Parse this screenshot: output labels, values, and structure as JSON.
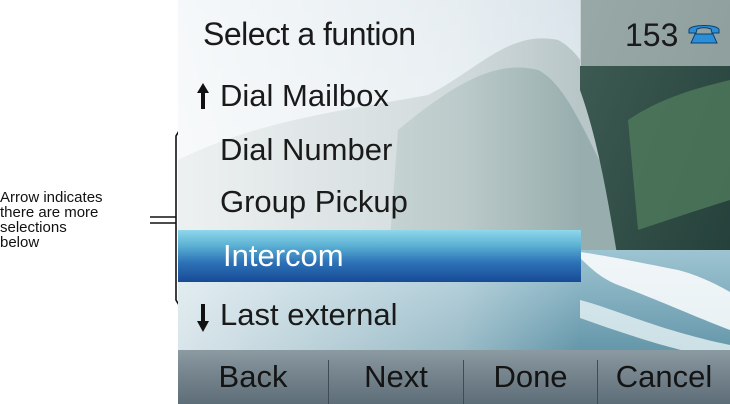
{
  "annotation": {
    "lines": [
      "Arrow indicates",
      "there are more",
      "selections",
      "below"
    ]
  },
  "screen": {
    "title": "Select a funtion",
    "status": {
      "line_number": "153",
      "icon": "phone-handset-icon",
      "icon_color": "#2a8fd8"
    },
    "menu": [
      {
        "label": "Dial Mailbox",
        "arrow": "up",
        "selected": false
      },
      {
        "label": "Dial Number",
        "arrow": "",
        "selected": false
      },
      {
        "label": "Group Pickup",
        "arrow": "",
        "selected": false
      },
      {
        "label": "Intercom",
        "arrow": "",
        "selected": true
      },
      {
        "label": "Last external",
        "arrow": "down",
        "selected": false
      }
    ],
    "selection_color": "#2e73b8",
    "softkeys": [
      {
        "label": "Back"
      },
      {
        "label": "Next"
      },
      {
        "label": "Done"
      },
      {
        "label": "Cancel"
      }
    ]
  }
}
